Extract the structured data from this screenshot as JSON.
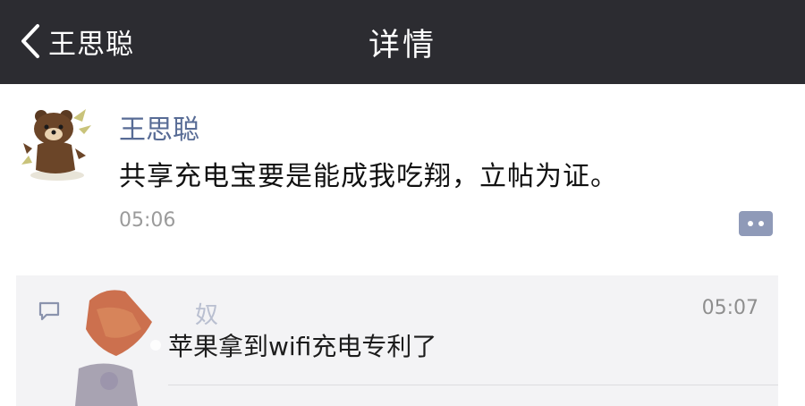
{
  "navbar": {
    "back_label": "王思聪",
    "title": "详情",
    "back_icon": "chevron-left-icon"
  },
  "post": {
    "author": "王思聪",
    "content": "共享充电宝要是能成我吃翔，立帖为证。",
    "time": "05:06",
    "avatar_icon": "bear-avatar",
    "action_icon": "comment-dots-icon"
  },
  "comments": {
    "icon": "comment-bubble-icon",
    "items": [
      {
        "name": "奴",
        "time": "05:07",
        "text": "苹果拿到wifi充电专利了"
      }
    ]
  },
  "colors": {
    "navbar_bg": "#2c2c31",
    "link_blue": "#576b95",
    "comment_bg": "#f3f3f5"
  }
}
